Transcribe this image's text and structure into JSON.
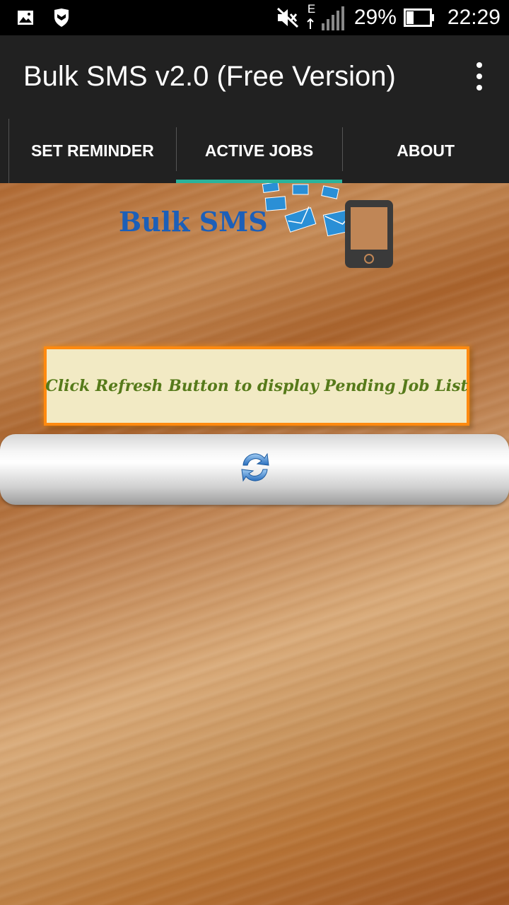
{
  "status_bar": {
    "network_type": "E",
    "battery_percent": "29%",
    "time": "22:29",
    "icons": [
      "image-icon",
      "shield-icon",
      "mute-icon",
      "signal-icon",
      "battery-icon"
    ]
  },
  "app_bar": {
    "title": "Bulk SMS v2.0 (Free Version)",
    "overflow_icon": "more-vert-icon"
  },
  "tabs": [
    {
      "label": "SET REMINDER",
      "active": false
    },
    {
      "label": "ACTIVE JOBS",
      "active": true
    },
    {
      "label": "ABOUT",
      "active": false
    }
  ],
  "accent_colors": {
    "tab_indicator": "#2bb39b",
    "logo_text": "#1c5fb8",
    "message_border": "#ff8a10",
    "message_text": "#567a1a"
  },
  "logo": {
    "text": "Bulk SMS",
    "icons": [
      "envelope-icon",
      "phone-icon"
    ]
  },
  "message": {
    "text": "Click Refresh Button to display Pending Job List"
  },
  "refresh_button": {
    "icon": "refresh-icon"
  }
}
